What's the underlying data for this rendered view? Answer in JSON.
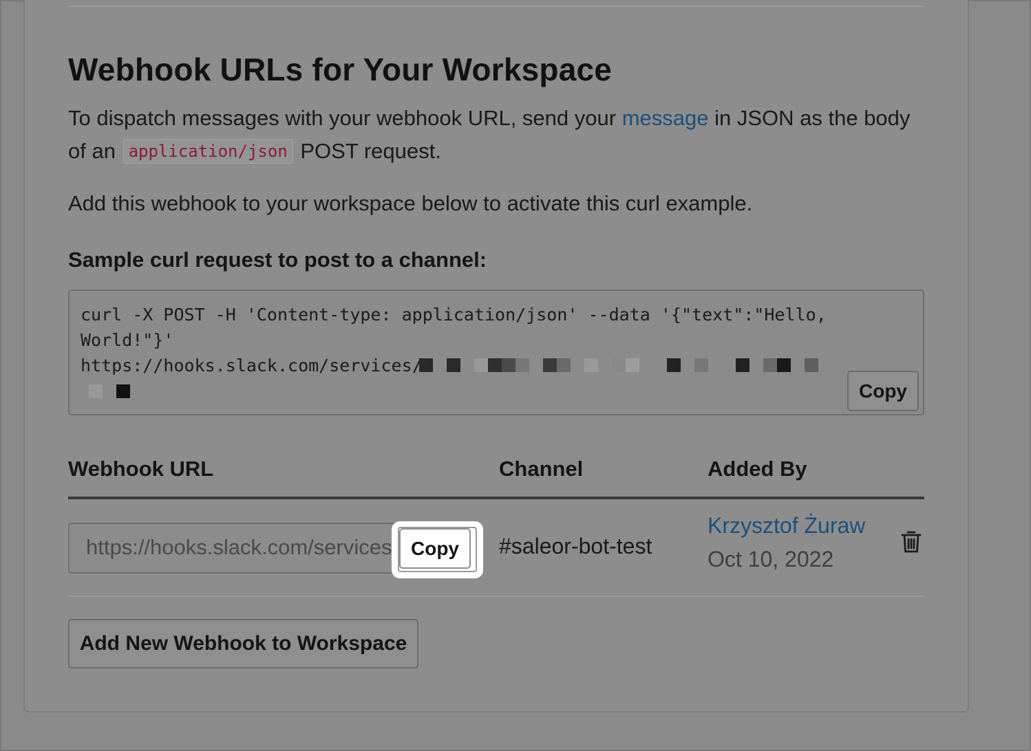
{
  "section": {
    "title": "Webhook URLs for Your Workspace",
    "desc_pre": "To dispatch messages with your webhook URL, send your ",
    "desc_link": "message",
    "desc_mid": " in JSON as the body of an ",
    "desc_code": "application/json",
    "desc_post": " POST request.",
    "note": "Add this webhook to your workspace below to activate this curl example.",
    "sample_heading": "Sample curl request to post to a channel:"
  },
  "code_sample": {
    "line1": "curl -X POST -H 'Content-type: application/json' --data '{\"text\":\"Hello,",
    "line2": "World!\"}'",
    "line3": "https://hooks.slack.com/services/",
    "copy_label": "Copy"
  },
  "table": {
    "headers": [
      "Webhook URL",
      "Channel",
      "Added By"
    ],
    "rows": [
      {
        "url": "https://hooks.slack.com/services/",
        "copy_label": "Copy",
        "channel": "#saleor-bot-test",
        "added_by": "Krzysztof Żuraw",
        "date": "Oct 10, 2022"
      }
    ]
  },
  "icons": {
    "delete": "trash-icon"
  },
  "add_button": "Add New Webhook to Workspace",
  "colors": {
    "link": "#1d4f7e",
    "overlay_bg": "#8a8a8a",
    "code_text": "#8a1a3a"
  }
}
